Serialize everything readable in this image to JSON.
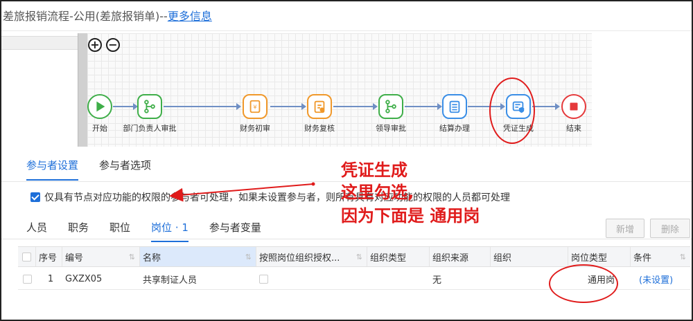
{
  "header": {
    "title": "差旅报销流程-公用(差旅报销单)--",
    "more_link": "更多信息"
  },
  "canvas": {
    "zoom_in": "+",
    "zoom_out": "−",
    "nodes": [
      {
        "label": "开始",
        "color": "#3fae49"
      },
      {
        "label": "部门负责人审批",
        "color": "#3fae49"
      },
      {
        "label": "财务初审",
        "color": "#f0982a"
      },
      {
        "label": "财务复核",
        "color": "#f0982a"
      },
      {
        "label": "领导审批",
        "color": "#3fae49"
      },
      {
        "label": "结算办理",
        "color": "#3a8ee6"
      },
      {
        "label": "凭证生成",
        "color": "#3a8ee6"
      },
      {
        "label": "结束",
        "color": "#e5393b"
      }
    ]
  },
  "tabs": [
    "参与者设置",
    "参与者选项"
  ],
  "checkbox_label": "仅具有节点对应功能的权限的参与者可处理，如果未设置参与者，则所有具有对应功能的权限的人员都可处理",
  "annotation": {
    "line1": "凭证生成",
    "line2": "这里勾选,",
    "line3": "因为下面是 通用岗",
    "color": "#e01b1b"
  },
  "subtabs": [
    "人员",
    "职务",
    "职位",
    "岗位 · 1",
    "参与者变量"
  ],
  "buttons": {
    "add": "新增",
    "delete": "删除"
  },
  "table": {
    "headers": [
      "序号",
      "编号",
      "名称",
      "按照岗位组织授权...",
      "组织类型",
      "组织来源",
      "组织",
      "岗位类型",
      "条件"
    ],
    "rows": [
      {
        "index": "1",
        "code": "GXZX05",
        "name": "共享制证人员",
        "org_source": "无",
        "post_type": "通用岗",
        "condition": "(未设置)"
      }
    ]
  },
  "colors": {
    "accent": "#1e6fd9",
    "annotation": "#e01b1b"
  }
}
